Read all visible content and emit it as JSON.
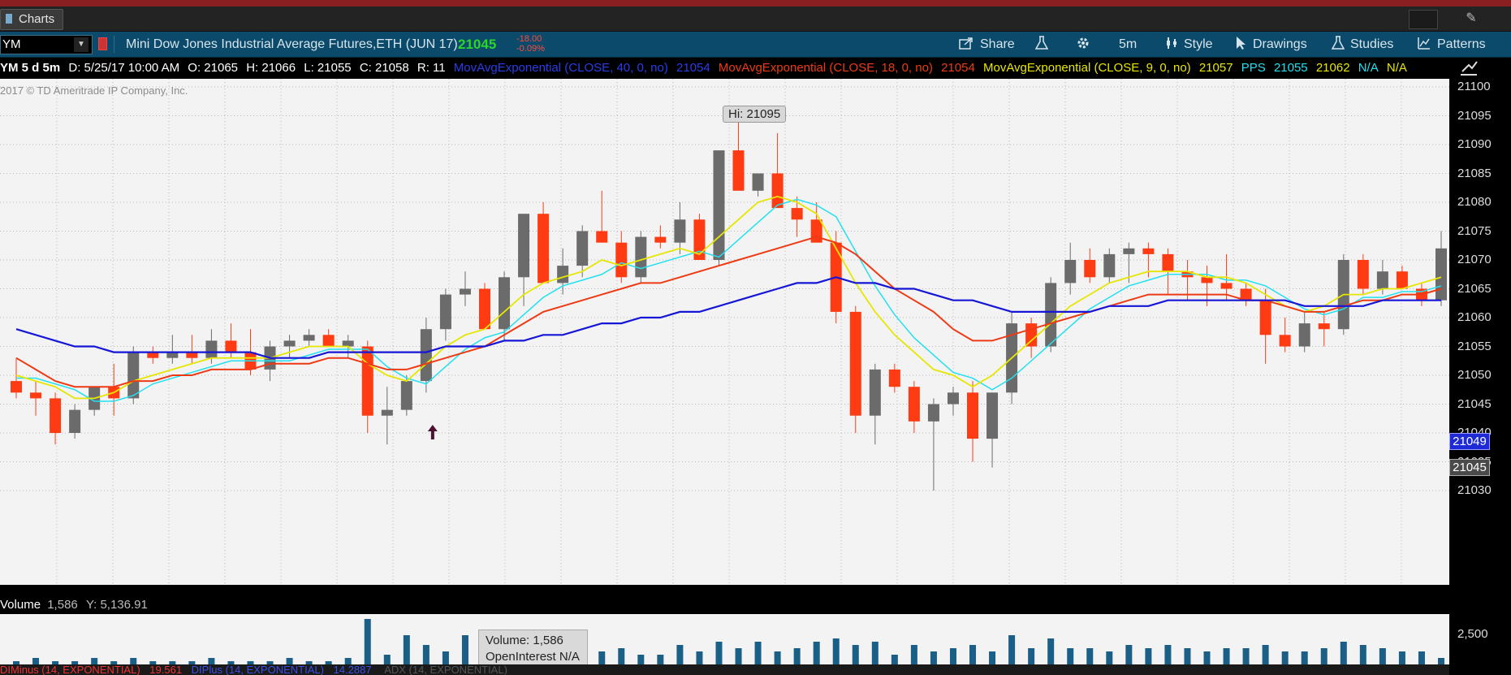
{
  "window": {
    "tab_label": "Charts"
  },
  "toolbar": {
    "symbol": "YM",
    "instrument": "Mini Dow Jones Industrial Average Futures,ETH (JUN 17)",
    "last_price": "21045",
    "change": "-18.00",
    "change_pct": "-0.09%",
    "share": "Share",
    "interval": "5m",
    "style": "Style",
    "drawings": "Drawings",
    "studies": "Studies",
    "patterns": "Patterns"
  },
  "studybar": {
    "header": "YM 5 d 5m",
    "date": "D: 5/25/17 10:00 AM",
    "open": "O: 21065",
    "high": "H: 21066",
    "low": "L: 21055",
    "close": "C: 21058",
    "range": "R: 11",
    "ema40_label": "MovAvgExponential (CLOSE, 40, 0, no)",
    "ema40_value": "21054",
    "ema18_label": "MovAvgExponential (CLOSE, 18, 0, no)",
    "ema18_value": "21054",
    "ema9_label": "MovAvgExponential (CLOSE, 9, 0, no)",
    "ema9_value": "21057",
    "pps_label": "PPS",
    "pps_v1": "21055",
    "pps_v2": "21062",
    "na1": "N/A",
    "na2": "N/A"
  },
  "chart": {
    "copyright": "2017 © TD Ameritrade IP Company, Inc.",
    "hi_label": "Hi: 21095",
    "price_label_blue": "21049",
    "price_label_gray": "21045"
  },
  "volume": {
    "label": "Volume",
    "value": "1,586",
    "y_readout": "Y: 5,136.91",
    "scale_label": "2,500",
    "tooltip_volume": "Volume: 1,586",
    "tooltip_oi": "OpenInterest N/A"
  },
  "bottom": {
    "di_minus": "DIMinus (14, EXPONENTIAL)",
    "di_minus_val": "19.561",
    "di_plus": "DIPlus (14, EXPONENTIAL)",
    "di_plus_val": "14.2887",
    "adx": "ADX (14, EXPONENTIAL)"
  },
  "colors": {
    "up": "#6b6b6b",
    "down": "#ff3b14",
    "ema40": "#1616d6",
    "ema18": "#ee3a14",
    "ema9": "#e6e600",
    "pps": "#22e0f0"
  },
  "chart_data": {
    "type": "candlestick",
    "yticks": [
      21100,
      21095,
      21090,
      21085,
      21080,
      21075,
      21070,
      21065,
      21060,
      21055,
      21050,
      21045,
      21040,
      21035,
      21030
    ],
    "ylim": [
      21027,
      21102
    ],
    "candles": [
      [
        21049,
        21053,
        21046,
        21047
      ],
      [
        21047,
        21049,
        21043,
        21046
      ],
      [
        21046,
        21047,
        21038,
        21040
      ],
      [
        21040,
        21045,
        21039,
        21044
      ],
      [
        21044,
        21048,
        21043,
        21048
      ],
      [
        21048,
        21052,
        21043,
        21046
      ],
      [
        21046,
        21055,
        21045,
        21054
      ],
      [
        21054,
        21055,
        21052,
        21053
      ],
      [
        21053,
        21057,
        21052,
        21054
      ],
      [
        21054,
        21057,
        21052,
        21053
      ],
      [
        21053,
        21058,
        21052,
        21056
      ],
      [
        21056,
        21059,
        21053,
        21054
      ],
      [
        21054,
        21058,
        21050,
        21051
      ],
      [
        21051,
        21056,
        21049,
        21055
      ],
      [
        21055,
        21057,
        21053,
        21056
      ],
      [
        21056,
        21058,
        21055,
        21057
      ],
      [
        21057,
        21058,
        21055,
        21055
      ],
      [
        21055,
        21057,
        21053,
        21056
      ],
      [
        21055,
        21056,
        21040,
        21043
      ],
      [
        21043,
        21048,
        21038,
        21044
      ],
      [
        21044,
        21050,
        21043,
        21049
      ],
      [
        21049,
        21060,
        21047,
        21058
      ],
      [
        21058,
        21065,
        21056,
        21064
      ],
      [
        21064,
        21068,
        21062,
        21065
      ],
      [
        21065,
        21066,
        21058,
        21058
      ],
      [
        21058,
        21068,
        21056,
        21067
      ],
      [
        21067,
        21078,
        21062,
        21078
      ],
      [
        21078,
        21080,
        21066,
        21066
      ],
      [
        21066,
        21072,
        21064,
        21069
      ],
      [
        21069,
        21076,
        21067,
        21075
      ],
      [
        21075,
        21082,
        21074,
        21073
      ],
      [
        21073,
        21075,
        21066,
        21067
      ],
      [
        21067,
        21075,
        21066,
        21074
      ],
      [
        21074,
        21076,
        21072,
        21073
      ],
      [
        21073,
        21080,
        21071,
        21077
      ],
      [
        21077,
        21078,
        21070,
        21070
      ],
      [
        21070,
        21089,
        21069,
        21089
      ],
      [
        21089,
        21094,
        21084,
        21082
      ],
      [
        21082,
        21085,
        21081,
        21085
      ],
      [
        21085,
        21092,
        21080,
        21079
      ],
      [
        21079,
        21081,
        21074,
        21077
      ],
      [
        21077,
        21080,
        21073,
        21073
      ],
      [
        21073,
        21075,
        21059,
        21061
      ],
      [
        21061,
        21062,
        21040,
        21043
      ],
      [
        21043,
        21052,
        21038,
        21051
      ],
      [
        21051,
        21052,
        21047,
        21048
      ],
      [
        21048,
        21049,
        21040,
        21042
      ],
      [
        21042,
        21046,
        21030,
        21045
      ],
      [
        21045,
        21048,
        21043,
        21047
      ],
      [
        21047,
        21049,
        21035,
        21039
      ],
      [
        21039,
        21047,
        21034,
        21047
      ],
      [
        21047,
        21061,
        21045,
        21059
      ],
      [
        21059,
        21060,
        21053,
        21055
      ],
      [
        21055,
        21067,
        21054,
        21066
      ],
      [
        21066,
        21073,
        21064,
        21070
      ],
      [
        21070,
        21072,
        21066,
        21067
      ],
      [
        21067,
        21072,
        21066,
        21071
      ],
      [
        21071,
        21073,
        21066,
        21072
      ],
      [
        21072,
        21073,
        21067,
        21071
      ],
      [
        21071,
        21072,
        21064,
        21068
      ],
      [
        21068,
        21070,
        21063,
        21067
      ],
      [
        21067,
        21069,
        21062,
        21066
      ],
      [
        21066,
        21071,
        21063,
        21065
      ],
      [
        21065,
        21066,
        21062,
        21063
      ],
      [
        21063,
        21065,
        21052,
        21057
      ],
      [
        21057,
        21060,
        21054,
        21055
      ],
      [
        21055,
        21061,
        21054,
        21059
      ],
      [
        21059,
        21061,
        21055,
        21058
      ],
      [
        21058,
        21071,
        21057,
        21070
      ],
      [
        21070,
        21071,
        21064,
        21065
      ],
      [
        21065,
        21070,
        21064,
        21068
      ],
      [
        21068,
        21069,
        21065,
        21065
      ],
      [
        21065,
        21066,
        21062,
        21063
      ],
      [
        21063,
        21075,
        21062,
        21072
      ]
    ],
    "ema40": [
      21058,
      21057,
      21056,
      21055,
      21055,
      21054,
      21054,
      21054,
      21054,
      21054,
      21054,
      21054,
      21054,
      21053,
      21053,
      21053,
      21054,
      21054,
      21054,
      21054,
      21054,
      21054,
      21055,
      21055,
      21055,
      21056,
      21056,
      21057,
      21057,
      21058,
      21059,
      21059,
      21060,
      21060,
      21061,
      21061,
      21062,
      21063,
      21064,
      21065,
      21066,
      21066,
      21067,
      21066,
      21066,
      21065,
      21065,
      21064,
      21063,
      21063,
      21062,
      21061,
      21061,
      21061,
      21061,
      21061,
      21062,
      21062,
      21062,
      21063,
      21063,
      21063,
      21063,
      21063,
      21063,
      21063,
      21062,
      21062,
      21062,
      21062,
      21063,
      21063,
      21063,
      21063
    ],
    "ema18": [
      21053,
      21051,
      21049,
      21048,
      21048,
      21048,
      21049,
      21049,
      21050,
      21050,
      21051,
      21051,
      21051,
      21052,
      21052,
      21052,
      21053,
      21053,
      21052,
      21051,
      21051,
      21052,
      21053,
      21054,
      21055,
      21057,
      21059,
      21061,
      21062,
      21063,
      21064,
      21065,
      21066,
      21066,
      21067,
      21068,
      21069,
      21070,
      21071,
      21072,
      21073,
      21074,
      21073,
      21071,
      21068,
      21065,
      21063,
      21061,
      21058,
      21056,
      21056,
      21057,
      21058,
      21059,
      21060,
      21061,
      21062,
      21063,
      21064,
      21064,
      21064,
      21064,
      21064,
      21063,
      21063,
      21062,
      21061,
      21061,
      21062,
      21063,
      21063,
      21064,
      21064,
      21065
    ],
    "ema9": [
      21050,
      21049,
      21048,
      21046,
      21046,
      21047,
      21049,
      21050,
      21051,
      21052,
      21053,
      21053,
      21053,
      21053,
      21054,
      21055,
      21055,
      21055,
      21052,
      21050,
      21049,
      21052,
      21055,
      21057,
      21058,
      21061,
      21064,
      21066,
      21067,
      21068,
      21070,
      21069,
      21070,
      21071,
      21072,
      21071,
      21074,
      21077,
      21080,
      21081,
      21080,
      21078,
      21072,
      21066,
      21061,
      21057,
      21054,
      21051,
      21050,
      21048,
      21050,
      21053,
      21056,
      21059,
      21062,
      21064,
      21066,
      21067,
      21068,
      21068,
      21068,
      21067,
      21067,
      21066,
      21064,
      21062,
      21061,
      21062,
      21064,
      21064,
      21065,
      21065,
      21066,
      21067
    ]
  }
}
